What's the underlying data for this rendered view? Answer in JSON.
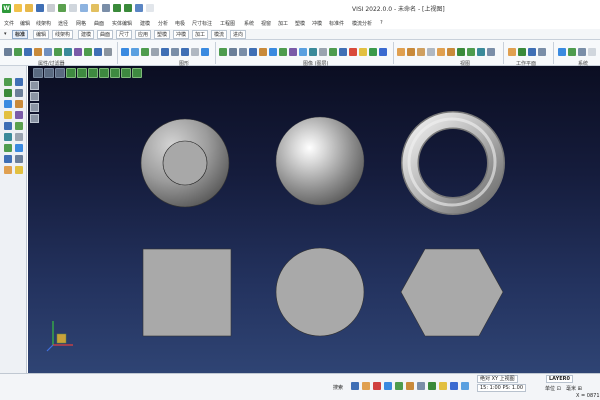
{
  "app": {
    "logo": "W",
    "title": "VISI 2022.0.0 - 未命名 - [上视图]"
  },
  "menu": [
    "文件",
    "编辑",
    "线架构",
    "途径",
    "网格",
    "曲面",
    "实体编辑",
    "建模",
    "分析",
    "电极",
    "尺寸标注",
    "工程图",
    "系统",
    "视窗",
    "加工",
    "塑模",
    "冲模",
    "标准件",
    "模流分析",
    "?"
  ],
  "ribbon_tabs": [
    "标准",
    "编辑",
    "线架构",
    "建模",
    "曲面",
    "尺寸",
    "应用",
    "塑模",
    "冲模",
    "加工",
    "模流",
    "进向"
  ],
  "active_tab": "标准",
  "ribbon_groups": [
    "属性/过滤器",
    "图形",
    "图像 (图层)",
    "视图",
    "工作平面",
    "系统"
  ],
  "status": {
    "view_mode": "绝对 XY 上视图",
    "scale": "15: 1:00 PS: 1.00",
    "layer": "LAYER0",
    "search": "搜索",
    "draw_mode": "单位 ⊡",
    "coord_label": "毫米 ⊞",
    "coord_x": "X = 0871"
  },
  "colors": {
    "viewport_top": "#0b0e22",
    "viewport_bottom": "#2f4474",
    "shape_flat": "#a9a9a9",
    "accent_green": "#2e9a3a"
  },
  "shapes": [
    "cylinder-icon",
    "sphere-icon",
    "torus-icon",
    "square-icon",
    "circle-icon",
    "hexagon-icon"
  ]
}
